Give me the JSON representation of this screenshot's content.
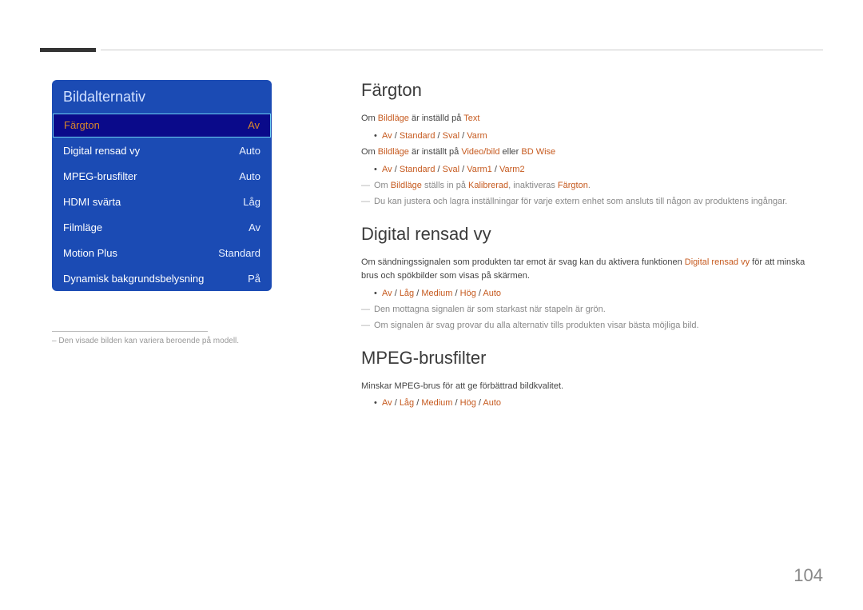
{
  "page_number": "104",
  "menu": {
    "title": "Bildalternativ",
    "items": [
      {
        "label": "Färgton",
        "value": "Av",
        "selected": true
      },
      {
        "label": "Digital rensad vy",
        "value": "Auto",
        "selected": false
      },
      {
        "label": "MPEG-brusfilter",
        "value": "Auto",
        "selected": false
      },
      {
        "label": "HDMI svärta",
        "value": "Låg",
        "selected": false
      },
      {
        "label": "Filmläge",
        "value": "Av",
        "selected": false
      },
      {
        "label": "Motion Plus",
        "value": "Standard",
        "selected": false
      },
      {
        "label": "Dynamisk bakgrundsbelysning",
        "value": "På",
        "selected": false
      }
    ]
  },
  "left_note": "Den visade bilden kan variera beroende på modell.",
  "sections": {
    "fargton": {
      "title": "Färgton",
      "line1a": "Om ",
      "line1_hl1": "Bildläge",
      "line1b": " är inställd på ",
      "line1_hl2": "Text",
      "bullet1": {
        "p0": "Av",
        "p1": "Standard",
        "p2": "Sval",
        "p3": "Varm"
      },
      "line2a": "Om ",
      "line2_hl1": "Bildläge",
      "line2b": " är inställt på ",
      "line2_hl2": "Video/bild",
      "line2c": " eller ",
      "line2_hl3": "BD Wise",
      "bullet2": {
        "p0": "Av",
        "p1": "Standard",
        "p2": "Sval",
        "p3": "Varm1",
        "p4": "Varm2"
      },
      "dash1a": "Om ",
      "dash1_hl1": "Bildläge",
      "dash1b": " ställs in på ",
      "dash1_hl2": "Kalibrerad",
      "dash1c": ", inaktiveras ",
      "dash1_hl3": "Färgton",
      "dash1d": ".",
      "dash2": "Du kan justera och lagra inställningar för varje extern enhet som ansluts till någon av produktens ingångar."
    },
    "digital": {
      "title": "Digital rensad vy",
      "line1a": "Om sändningssignalen som produkten tar emot är svag kan du aktivera funktionen ",
      "line1_hl1": "Digital rensad vy",
      "line1b": " för att minska brus och spökbilder som visas på skärmen.",
      "bullet1": {
        "p0": "Av",
        "p1": "Låg",
        "p2": "Medium",
        "p3": "Hög",
        "p4": "Auto"
      },
      "dash1": "Den mottagna signalen är som starkast när stapeln är grön.",
      "dash2": "Om signalen är svag provar du alla alternativ tills produkten visar bästa möjliga bild."
    },
    "mpeg": {
      "title": "MPEG-brusfilter",
      "line1": "Minskar MPEG-brus för att ge förbättrad bildkvalitet.",
      "bullet1": {
        "p0": "Av",
        "p1": "Låg",
        "p2": "Medium",
        "p3": "Hög",
        "p4": "Auto"
      }
    }
  }
}
